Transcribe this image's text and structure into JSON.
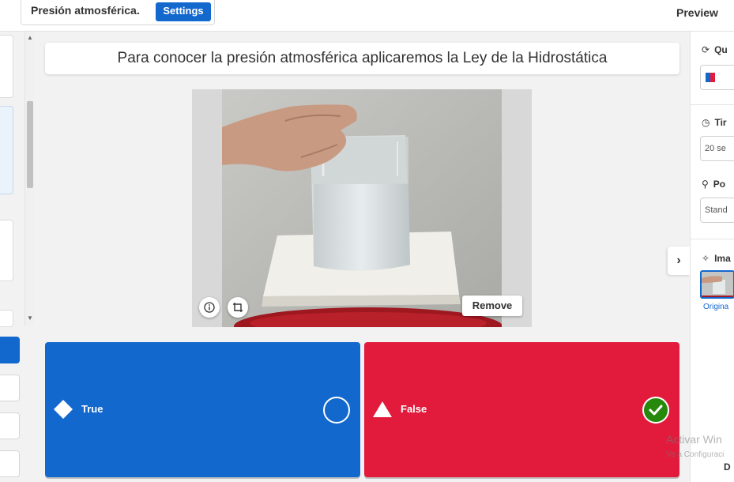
{
  "header": {
    "quiz_title": "Presión atmosférica.",
    "settings_label": "Settings",
    "preview_label": "Preview"
  },
  "question": {
    "text": "Para conocer la presión atmosférica aplicaremos la Ley de la Hidrostática"
  },
  "media": {
    "remove_label": "Remove",
    "info_icon": "info-icon",
    "crop_icon": "crop-icon"
  },
  "answers": [
    {
      "label": "True",
      "shape": "diamond",
      "color": "#1368ce",
      "correct": false
    },
    {
      "label": "False",
      "shape": "triangle",
      "color": "#e21b3c",
      "correct": true
    }
  ],
  "right_panel": {
    "question_type_heading": "Qu",
    "time_limit_heading": "Tir",
    "time_limit_value": "20 se",
    "points_heading": "Po",
    "points_value": "Stand",
    "image_reveal_heading": "Ima",
    "image_link": "Origina"
  },
  "watermark": {
    "line1": "Activar Win",
    "line2": "Ve a Configuraci",
    "corner": "D"
  },
  "colors": {
    "accent": "#1368ce",
    "true_answer": "#1368ce",
    "false_answer": "#e21b3c",
    "correct_check": "#26890c"
  }
}
